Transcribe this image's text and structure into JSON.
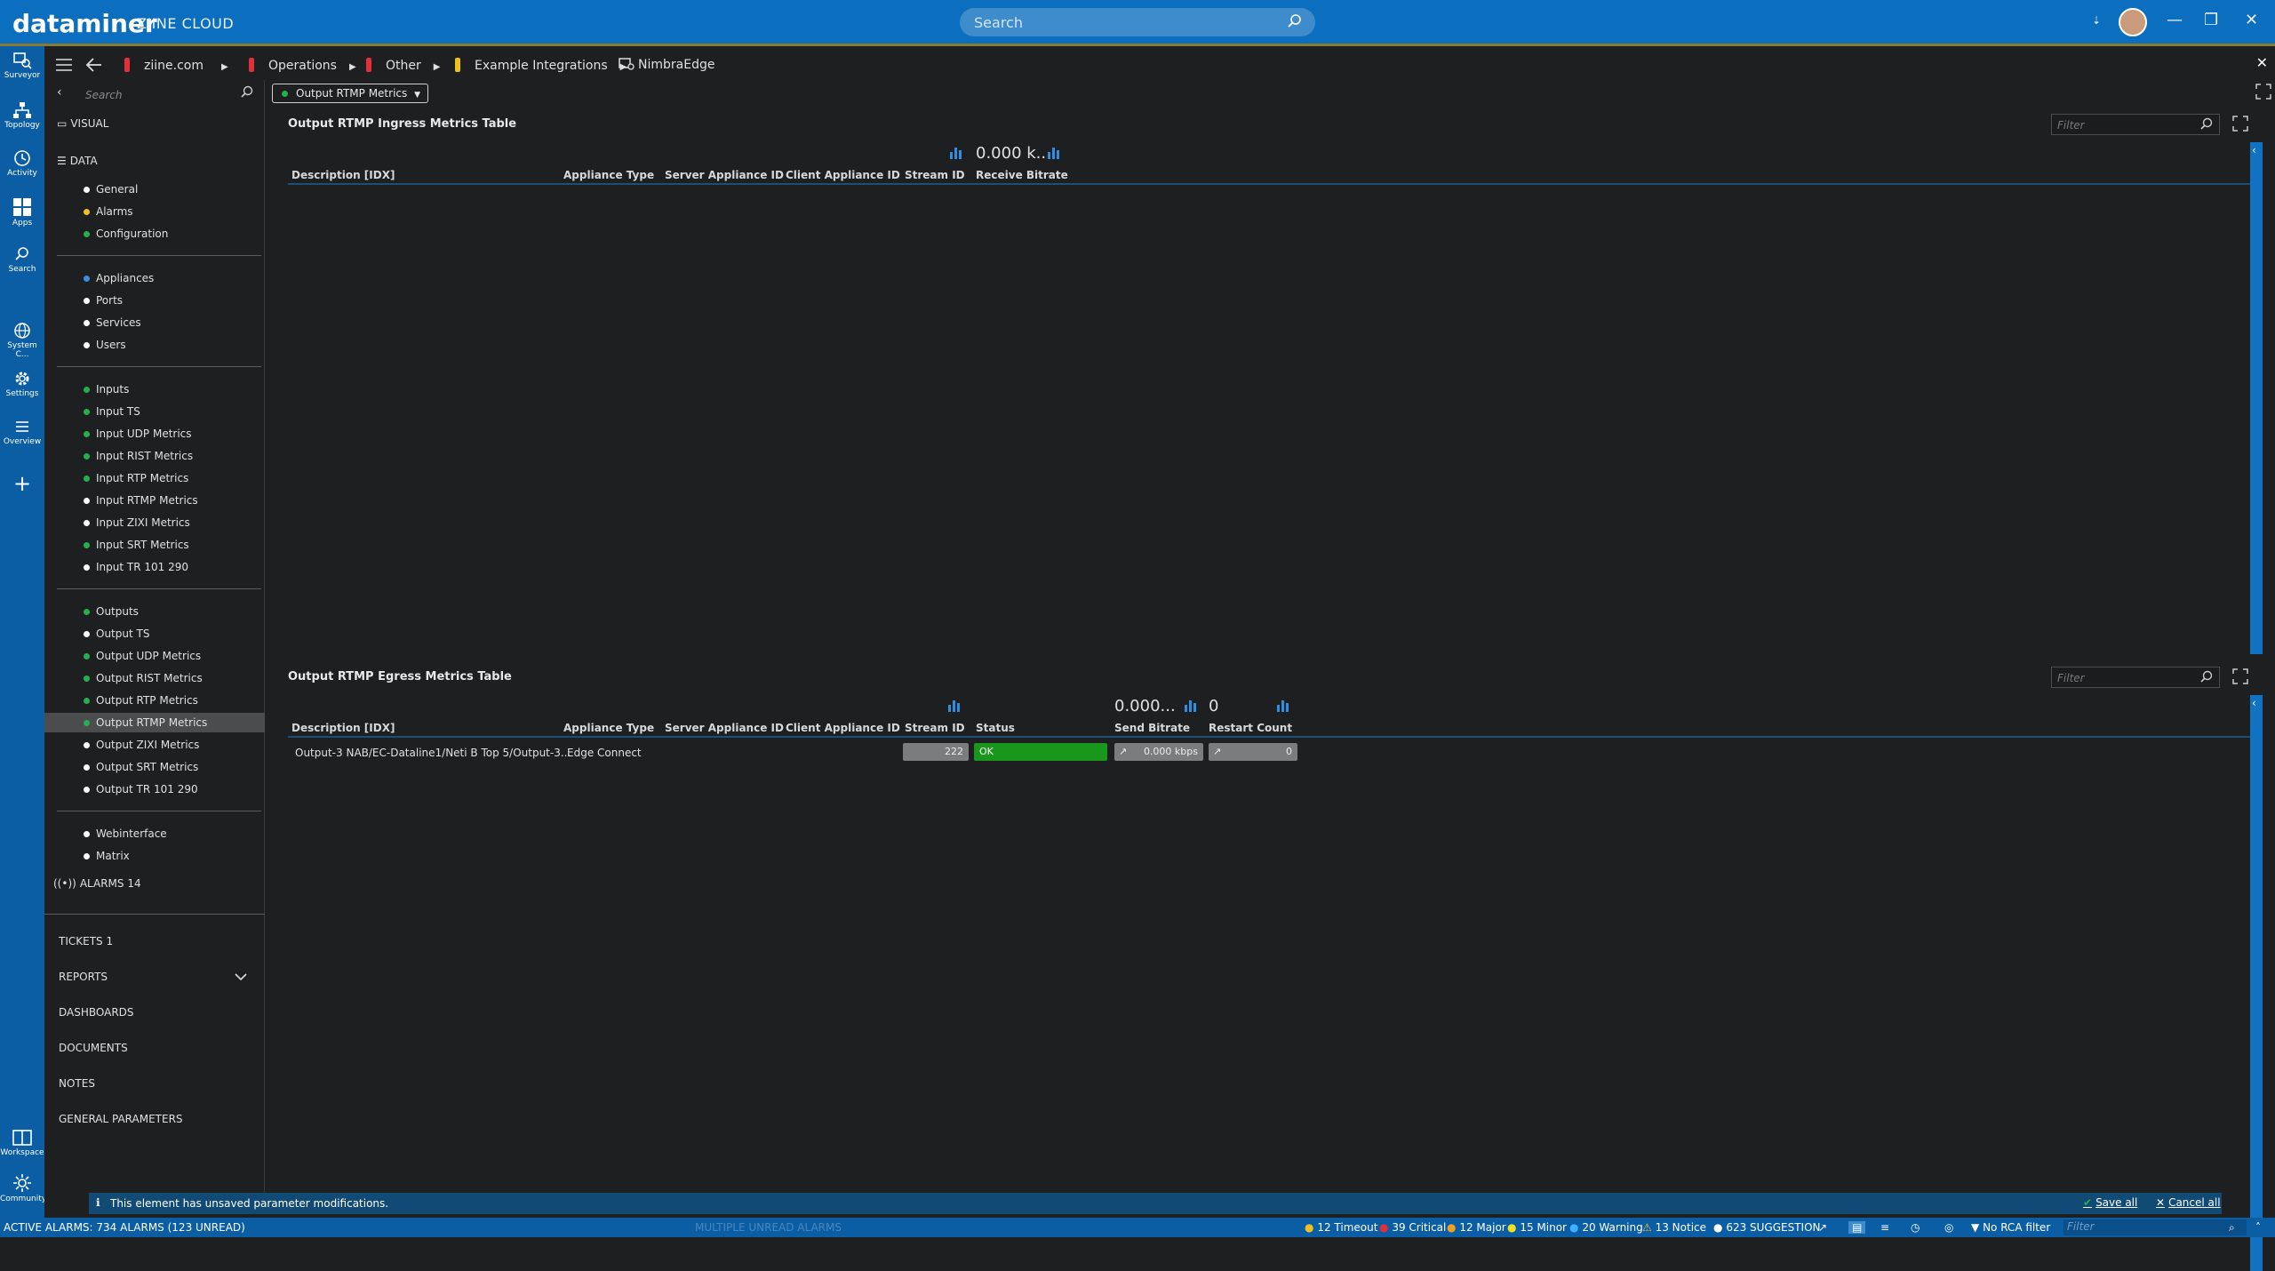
{
  "app": {
    "brand": "dataminer",
    "subtitle": "ZIINE CLOUD",
    "search_placeholder": "Search"
  },
  "nav": [
    {
      "label": "Surveyor",
      "icon": "surveyor-icon"
    },
    {
      "label": "Topology",
      "icon": "topology-icon"
    },
    {
      "label": "Activity",
      "icon": "activity-icon"
    },
    {
      "label": "Apps",
      "icon": "apps-icon"
    },
    {
      "label": "Search",
      "icon": "search-icon"
    },
    {
      "label": "System C...",
      "icon": "globe-icon"
    },
    {
      "label": "Settings",
      "icon": "gear-icon"
    },
    {
      "label": "Overview",
      "icon": "list-icon"
    },
    {
      "label": "Workspace",
      "icon": "workspace-icon"
    },
    {
      "label": "Community",
      "icon": "community-icon"
    }
  ],
  "breadcrumbs": [
    {
      "label": "ziine.com",
      "color": "#e0303a"
    },
    {
      "label": "Operations",
      "color": "#e0303a"
    },
    {
      "label": "Other",
      "color": "#e0303a"
    },
    {
      "label": "Example Integrations",
      "color": "#f0c020"
    },
    {
      "label": "NimbraEdge",
      "color": ""
    }
  ],
  "sidebar": {
    "search_placeholder": "Search",
    "visual": "VISUAL",
    "data": "DATA",
    "groups": [
      [
        {
          "label": "General",
          "color": "#ffffff"
        },
        {
          "label": "Alarms",
          "color": "#f0c020"
        },
        {
          "label": "Configuration",
          "color": "#22b14c"
        }
      ],
      [
        {
          "label": "Appliances",
          "color": "#3a8fe0"
        },
        {
          "label": "Ports",
          "color": "#ffffff"
        },
        {
          "label": "Services",
          "color": "#ffffff"
        },
        {
          "label": "Users",
          "color": "#ffffff"
        }
      ],
      [
        {
          "label": "Inputs",
          "color": "#22b14c"
        },
        {
          "label": "Input TS",
          "color": "#22b14c"
        },
        {
          "label": "Input UDP Metrics",
          "color": "#22b14c"
        },
        {
          "label": "Input RIST Metrics",
          "color": "#22b14c"
        },
        {
          "label": "Input RTP Metrics",
          "color": "#22b14c"
        },
        {
          "label": "Input RTMP Metrics",
          "color": "#ffffff"
        },
        {
          "label": "Input ZIXI Metrics",
          "color": "#ffffff"
        },
        {
          "label": "Input SRT Metrics",
          "color": "#22b14c"
        },
        {
          "label": "Input TR 101 290",
          "color": "#ffffff"
        }
      ],
      [
        {
          "label": "Outputs",
          "color": "#22b14c"
        },
        {
          "label": "Output TS",
          "color": "#ffffff"
        },
        {
          "label": "Output UDP Metrics",
          "color": "#22b14c"
        },
        {
          "label": "Output RIST Metrics",
          "color": "#22b14c"
        },
        {
          "label": "Output RTP Metrics",
          "color": "#22b14c"
        },
        {
          "label": "Output RTMP Metrics",
          "color": "#22b14c",
          "selected": true
        },
        {
          "label": "Output ZIXI Metrics",
          "color": "#ffffff"
        },
        {
          "label": "Output SRT Metrics",
          "color": "#ffffff"
        },
        {
          "label": "Output TR 101 290",
          "color": "#ffffff"
        }
      ],
      [
        {
          "label": "Webinterface",
          "color": "#ffffff"
        },
        {
          "label": "Matrix",
          "color": "#ffffff"
        }
      ]
    ],
    "alarms": "ALARMS 14",
    "bottom": [
      "TICKETS 1",
      "REPORTS",
      "DASHBOARDS",
      "DOCUMENTS",
      "NOTES",
      "GENERAL PARAMETERS"
    ]
  },
  "page_dropdown": "Output RTMP Metrics",
  "ingress": {
    "title": "Output RTMP Ingress Metrics Table",
    "filter_placeholder": "Filter",
    "aggregate": "0.000 k...",
    "columns": [
      "Description [IDX]",
      "Appliance Type",
      "Server Appliance ID",
      "Client Appliance ID",
      "Stream ID",
      "Receive Bitrate"
    ]
  },
  "egress": {
    "title": "Output RTMP Egress Metrics Table",
    "filter_placeholder": "Filter",
    "aggregate_bitrate": "0.000...",
    "aggregate_restart": "0",
    "columns": [
      "Description [IDX]",
      "Appliance Type",
      "Server Appliance ID",
      "Client Appliance ID",
      "Stream ID",
      "Status",
      "Send Bitrate",
      "Restart Count"
    ],
    "row": {
      "description": "Output-3 NAB/EC-Dataline1/Neti B Top 5/Output-3...",
      "appliance_type": "Edge Connect",
      "stream_id": "222",
      "status": "OK",
      "send_bitrate": "0.000 kbps",
      "restart_count": "0"
    }
  },
  "notice": {
    "text": "This element has unsaved parameter modifications.",
    "save": "Save all",
    "cancel": "Cancel all"
  },
  "status": {
    "active": "ACTIVE ALARMS: 734 ALARMS (123 UNREAD)",
    "unread": "MULTIPLE UNREAD ALARMS",
    "timeout": "12 Timeout",
    "critical": "39 Critical",
    "major": "12 Major",
    "minor": "15 Minor",
    "warning": "20 Warning",
    "notice": "13 Notice",
    "suggestion": "623 SUGGESTION",
    "rca": "No RCA filter",
    "filter_placeholder": "Filter"
  }
}
